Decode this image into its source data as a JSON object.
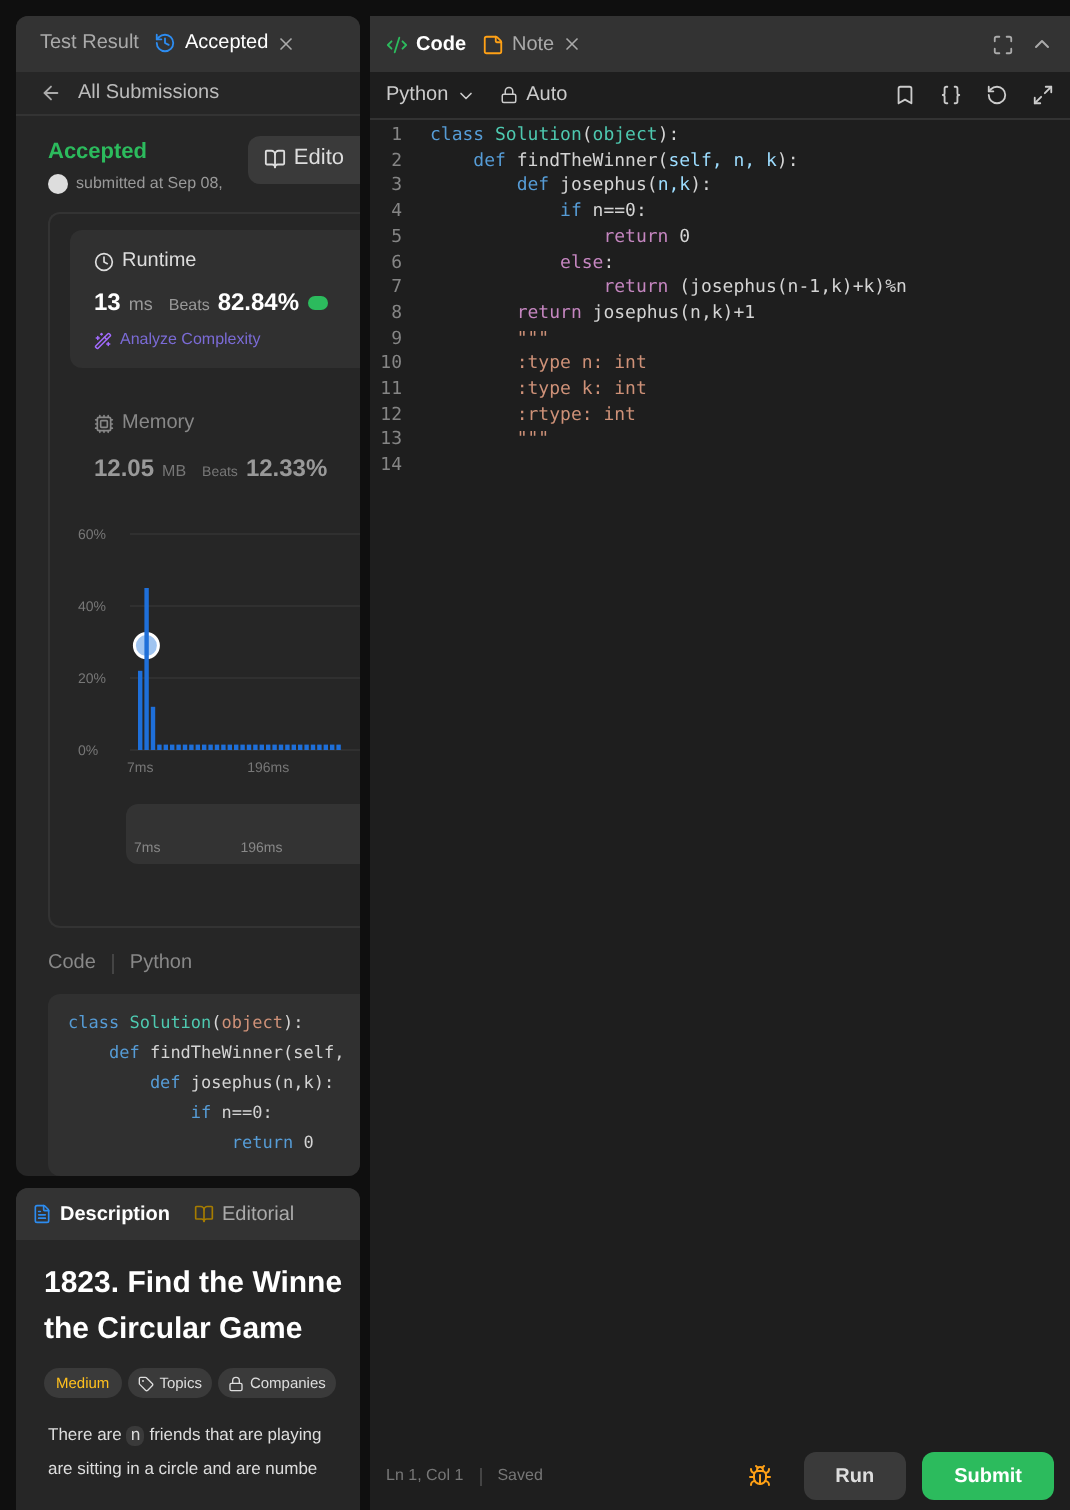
{
  "left_tabs": [
    {
      "label": "Test Result",
      "selected": false,
      "closable": false
    },
    {
      "label": "Accepted",
      "selected": true,
      "closable": true
    }
  ],
  "back_link": "All Submissions",
  "result": {
    "status": "Accepted",
    "submitted": "submitted at Sep 08,",
    "editorial_button": "Edito"
  },
  "runtime": {
    "title": "Runtime",
    "value": "13",
    "unit": "ms",
    "beats_label": "Beats",
    "beats": "82.84%",
    "analyze": "Analyze Complexity"
  },
  "memory": {
    "title": "Memory",
    "value": "12.05",
    "unit": "MB",
    "beats_label": "Beats",
    "beats": "12.33%"
  },
  "chart_data": {
    "type": "bar",
    "categories": [
      "7ms",
      null,
      null,
      null,
      null,
      null,
      null,
      null,
      null,
      null,
      null,
      null,
      null,
      null,
      null,
      null,
      null,
      null,
      null,
      null,
      "196ms",
      null,
      null,
      null,
      null,
      null,
      null,
      null,
      null,
      null,
      null,
      null
    ],
    "values": [
      22,
      45,
      12,
      1.5,
      1.5,
      1.5,
      1.5,
      1.5,
      1.5,
      1.5,
      1.5,
      1.5,
      1.5,
      1.5,
      1.5,
      1.5,
      1.5,
      1.5,
      1.5,
      1.5,
      1.5,
      1.5,
      1.5,
      1.5,
      1.5,
      1.5,
      1.5,
      1.5,
      1.5,
      1.5,
      1.5,
      1.5
    ],
    "ylim": [
      0,
      60
    ],
    "yticks": [
      {
        "value": 0,
        "label": "0%"
      },
      {
        "value": 20,
        "label": "20%"
      },
      {
        "value": 40,
        "label": "40%"
      },
      {
        "value": 60,
        "label": "60%"
      }
    ]
  },
  "range_labels": [
    "7ms",
    "196ms"
  ],
  "code_header": {
    "label": "Code",
    "language": "Python"
  },
  "snippet": [
    [
      {
        "kind": "keyword",
        "text": "class "
      },
      {
        "kind": "class",
        "text": "Solution"
      },
      {
        "kind": "plain",
        "text": "("
      },
      {
        "kind": "builtin",
        "text": "object"
      },
      {
        "kind": "plain",
        "text": "):"
      }
    ],
    [
      {
        "kind": "keyword",
        "text": "    def "
      },
      {
        "kind": "plain",
        "text": "findTheWinner(self,"
      }
    ],
    [
      {
        "kind": "keyword",
        "text": "        def "
      },
      {
        "kind": "plain",
        "text": "josephus(n,k):"
      }
    ],
    [
      {
        "kind": "keyword",
        "text": "            if "
      },
      {
        "kind": "plain",
        "text": "n==0:"
      }
    ],
    [
      {
        "kind": "keyword",
        "text": "                return "
      },
      {
        "kind": "plain",
        "text": "0"
      }
    ]
  ],
  "desc_tabs": [
    {
      "label": "Description",
      "selected": true
    },
    {
      "label": "Editorial",
      "selected": false
    }
  ],
  "problem": {
    "title_lines": [
      "1823. Find the Winne",
      "the Circular Game"
    ],
    "difficulty": "Medium",
    "tags": [
      "Topics",
      "Companies"
    ],
    "text_before": "There are",
    "code": "n",
    "text_after": "friends that are playing",
    "line2": "are sitting in a circle and are numbe"
  },
  "editor_tabs": [
    {
      "label": "Code",
      "selected": true,
      "closable": false
    },
    {
      "label": "Note",
      "selected": false,
      "closable": true
    }
  ],
  "language": "Python",
  "mode": "Auto",
  "code": [
    {
      "number": "1",
      "tokens": [
        {
          "kind": "keyword",
          "text": "class "
        },
        {
          "kind": "class",
          "text": "Solution"
        },
        {
          "kind": "plain",
          "text": "("
        },
        {
          "kind": "class",
          "text": "object"
        },
        {
          "kind": "plain",
          "text": "):"
        }
      ]
    },
    {
      "number": "2",
      "tokens": [
        {
          "kind": "keyword",
          "text": "    def "
        },
        {
          "kind": "plain",
          "text": "findTheWinner("
        },
        {
          "kind": "param",
          "text": "self, n, k"
        },
        {
          "kind": "plain",
          "text": "):"
        }
      ]
    },
    {
      "number": "3",
      "tokens": [
        {
          "kind": "keyword",
          "text": "        def "
        },
        {
          "kind": "plain",
          "text": "josephus("
        },
        {
          "kind": "param",
          "text": "n,k"
        },
        {
          "kind": "plain",
          "text": "):"
        }
      ]
    },
    {
      "number": "4",
      "tokens": [
        {
          "kind": "keyword",
          "text": "            if "
        },
        {
          "kind": "plain",
          "text": "n==0:"
        }
      ]
    },
    {
      "number": "5",
      "tokens": [
        {
          "kind": "control",
          "text": "                return "
        },
        {
          "kind": "plain",
          "text": "0"
        }
      ]
    },
    {
      "number": "6",
      "tokens": [
        {
          "kind": "control",
          "text": "            else"
        },
        {
          "kind": "plain",
          "text": ":"
        }
      ]
    },
    {
      "number": "7",
      "tokens": [
        {
          "kind": "control",
          "text": "                return "
        },
        {
          "kind": "plain",
          "text": "(josephus(n-1,k)+k)%n"
        }
      ]
    },
    {
      "number": "8",
      "tokens": [
        {
          "kind": "control",
          "text": "        return "
        },
        {
          "kind": "plain",
          "text": "josephus(n,k)+1"
        }
      ]
    },
    {
      "number": "9",
      "tokens": [
        {
          "kind": "string",
          "text": "        \"\"\""
        }
      ]
    },
    {
      "number": "10",
      "tokens": [
        {
          "kind": "string",
          "text": "        :type n: int"
        }
      ]
    },
    {
      "number": "11",
      "tokens": [
        {
          "kind": "string",
          "text": "        :type k: int"
        }
      ]
    },
    {
      "number": "12",
      "tokens": [
        {
          "kind": "string",
          "text": "        :rtype: int"
        }
      ]
    },
    {
      "number": "13",
      "tokens": [
        {
          "kind": "string",
          "text": "        \"\"\""
        }
      ]
    },
    {
      "number": "14"
    }
  ],
  "status": {
    "position": "Ln 1, Col 1",
    "saved": "Saved"
  },
  "buttons": [
    {
      "kind": "secondary",
      "label": "Run"
    },
    {
      "kind": "primary",
      "label": "Submit"
    }
  ]
}
